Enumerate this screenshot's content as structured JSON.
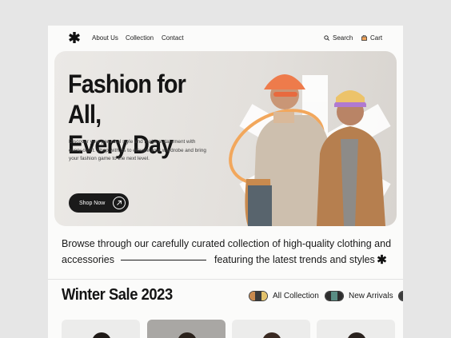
{
  "nav": {
    "links": [
      "About Us",
      "Collection",
      "Contact"
    ],
    "search_label": "Search",
    "cart_label": "Cart"
  },
  "hero": {
    "title_line1": "Fashion for All,",
    "title_line2": "Every Day",
    "description": "Discover your personal style and make a statement with every outfit. Shop with us to elevate your wardrobe and bring your fashion game to the next level.",
    "cta_label": "Shop Now"
  },
  "tagline": {
    "line1": "Browse through our carefully curated collection of high-quality clothing and",
    "line2_left": "accessories",
    "line2_right": "featuring the latest trends and styles"
  },
  "sale": {
    "title": "Winter Sale 2023",
    "chips": [
      "All Collection",
      "New Arrivals"
    ]
  },
  "colors": {
    "text": "#1a1a1a",
    "hero_bg": "#e3e0dc",
    "button": "#1a1a1a",
    "accent_orange": "#f0a45a"
  }
}
